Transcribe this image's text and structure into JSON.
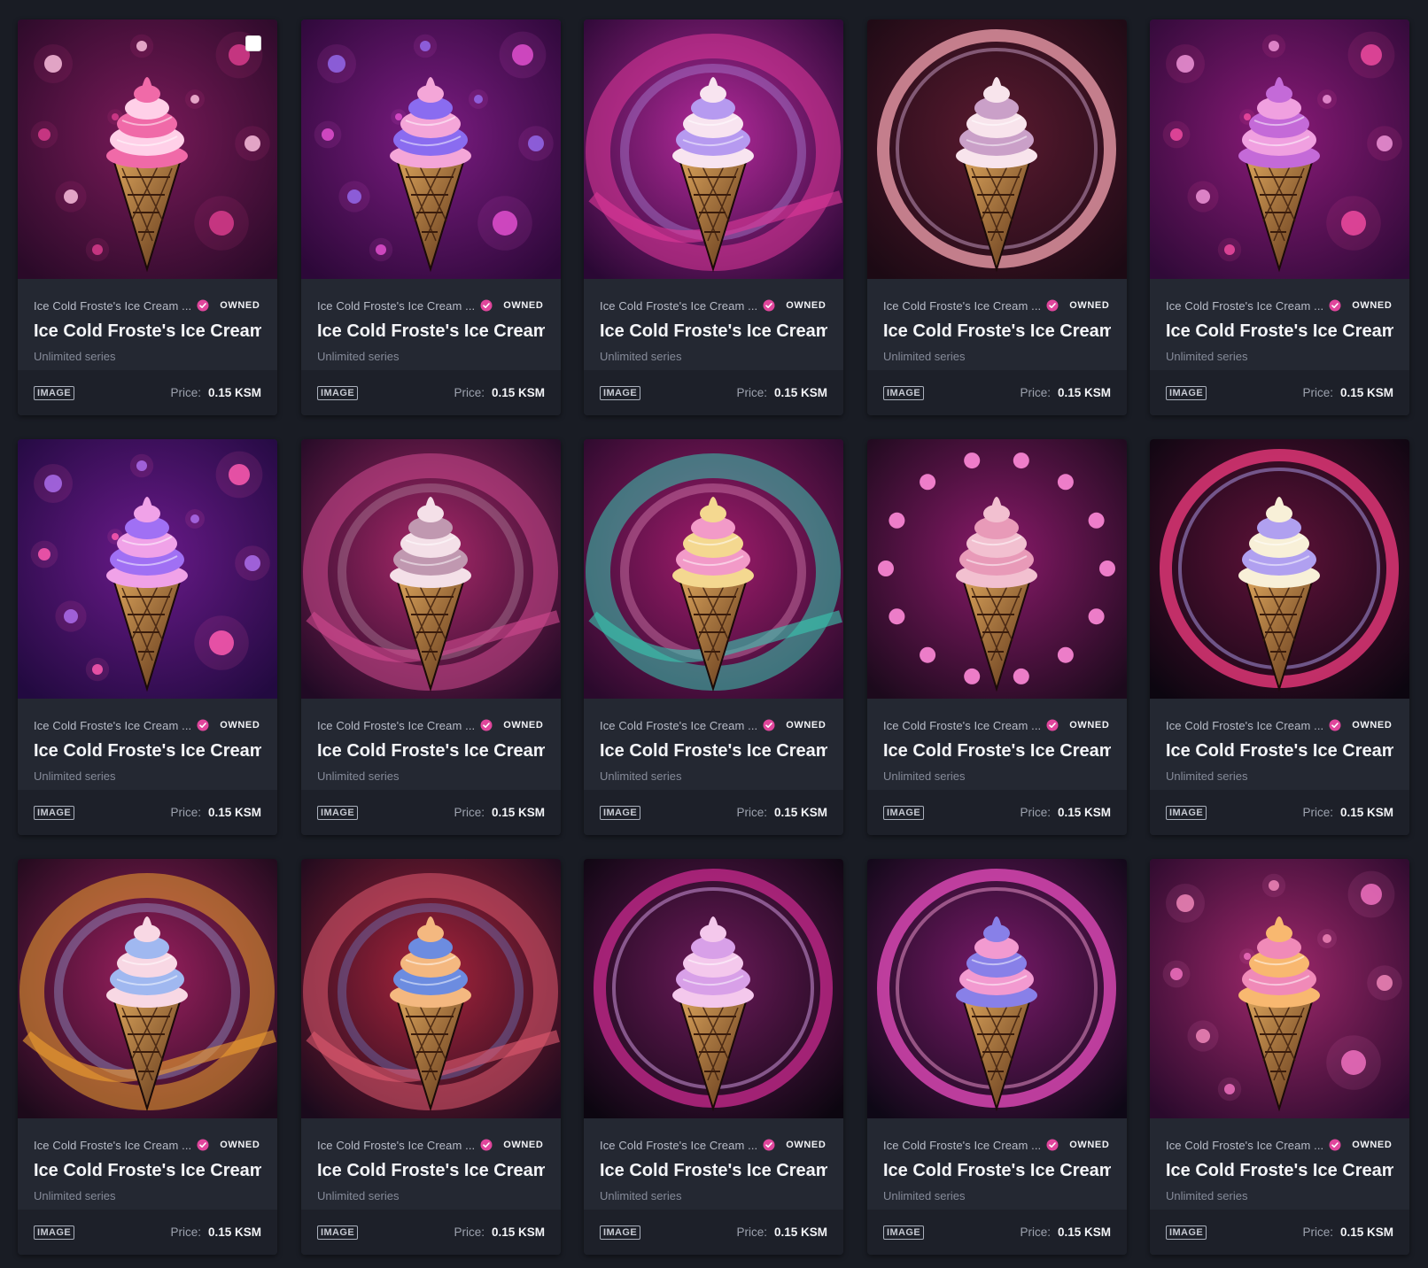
{
  "gallery": {
    "cards": [
      {
        "collection": "Ice Cold Froste's Ice Cream ...",
        "owned": "OWNED",
        "name": "Ice Cold Froste's Ice Cream S",
        "series": "Unlimited series",
        "media": "IMAGE",
        "price_label": "Price:",
        "price": "0.15 KSM",
        "art": {
          "bg1": "#7a1a5a",
          "bg2": "#2a0a28",
          "scoop1": "#f06aa8",
          "scoop2": "#ffd0e8",
          "ring": "#d83c8c",
          "style": "bubbles"
        }
      },
      {
        "collection": "Ice Cold Froste's Ice Cream ...",
        "owned": "OWNED",
        "name": "Ice Cold Froste's Ice Cream S",
        "series": "Unlimited series",
        "media": "IMAGE",
        "price_label": "Price:",
        "price": "0.15 KSM",
        "art": {
          "bg1": "#7c1c82",
          "bg2": "#2c0838",
          "scoop1": "#f4a6d8",
          "scoop2": "#8a6cf0",
          "ring": "#e24fcf",
          "style": "bubbles"
        }
      },
      {
        "collection": "Ice Cold Froste's Ice Cream ...",
        "owned": "OWNED",
        "name": "Ice Cold Froste's Ice Cream S",
        "series": "Unlimited series",
        "media": "IMAGE",
        "price_label": "Price:",
        "price": "0.15 KSM",
        "art": {
          "bg1": "#b42a9c",
          "bg2": "#2a0834",
          "scoop1": "#f8e4f0",
          "scoop2": "#b69af0",
          "ring": "#e0389a",
          "style": "swirl"
        }
      },
      {
        "collection": "Ice Cold Froste's Ice Cream ...",
        "owned": "OWNED",
        "name": "Ice Cold Froste's Ice Cream S",
        "series": "Unlimited series",
        "media": "IMAGE",
        "price_label": "Price:",
        "price": "0.15 KSM",
        "art": {
          "bg1": "#5a1a30",
          "bg2": "#1c0a14",
          "scoop1": "#f8e4ec",
          "scoop2": "#caa0c8",
          "ring": "#e89aa8",
          "style": "halo"
        }
      },
      {
        "collection": "Ice Cold Froste's Ice Cream ...",
        "owned": "OWNED",
        "name": "Ice Cold Froste's Ice Cream S",
        "series": "Unlimited series",
        "media": "IMAGE",
        "price_label": "Price:",
        "price": "0.15 KSM",
        "art": {
          "bg1": "#8a1a78",
          "bg2": "#300a38",
          "scoop1": "#c46ad8",
          "scoop2": "#f0a0e0",
          "ring": "#f04aa0",
          "style": "bubbles"
        }
      },
      {
        "collection": "Ice Cold Froste's Ice Cream ...",
        "owned": "OWNED",
        "name": "Ice Cold Froste's Ice Cream S",
        "series": "Unlimited series",
        "media": "IMAGE",
        "price_label": "Price:",
        "price": "0.15 KSM",
        "art": {
          "bg1": "#6a1a8a",
          "bg2": "#220a40",
          "scoop1": "#f0a2e8",
          "scoop2": "#a070f4",
          "ring": "#ff5ab0",
          "style": "bubbles"
        }
      },
      {
        "collection": "Ice Cold Froste's Ice Cream ...",
        "owned": "OWNED",
        "name": "Ice Cold Froste's Ice Cream S",
        "series": "Unlimited series",
        "media": "IMAGE",
        "price_label": "Price:",
        "price": "0.15 KSM",
        "art": {
          "bg1": "#a8286a",
          "bg2": "#200a24",
          "scoop1": "#f4e0e8",
          "scoop2": "#c098b0",
          "ring": "#d04a90",
          "style": "swirl"
        }
      },
      {
        "collection": "Ice Cold Froste's Ice Cream ...",
        "owned": "OWNED",
        "name": "Ice Cold Froste's Ice Cream S",
        "series": "Unlimited series",
        "media": "IMAGE",
        "price_label": "Price:",
        "price": "0.15 KSM",
        "art": {
          "bg1": "#a01c6c",
          "bg2": "#2a0a2c",
          "scoop1": "#f4d890",
          "scoop2": "#f29ac8",
          "ring": "#38c8b0",
          "style": "swirl"
        }
      },
      {
        "collection": "Ice Cold Froste's Ice Cream ...",
        "owned": "OWNED",
        "name": "Ice Cold Froste's Ice Cream S",
        "series": "Unlimited series",
        "media": "IMAGE",
        "price_label": "Price:",
        "price": "0.15 KSM",
        "art": {
          "bg1": "#8a1a6a",
          "bg2": "#1c0a1c",
          "scoop1": "#f2c0d0",
          "scoop2": "#e89ab8",
          "ring": "#ff8ad8",
          "style": "dots"
        }
      },
      {
        "collection": "Ice Cold Froste's Ice Cream ...",
        "owned": "OWNED",
        "name": "Ice Cold Froste's Ice Cream S",
        "series": "Unlimited series",
        "media": "IMAGE",
        "price_label": "Price:",
        "price": "0.15 KSM",
        "art": {
          "bg1": "#60123a",
          "bg2": "#0c0610",
          "scoop1": "#f8f0d8",
          "scoop2": "#b0a0f0",
          "ring": "#e8387a",
          "style": "halo"
        }
      },
      {
        "collection": "Ice Cold Froste's Ice Cream ...",
        "owned": "OWNED",
        "name": "Ice Cold Froste's Ice Cream S",
        "series": "Unlimited series",
        "media": "IMAGE",
        "price_label": "Price:",
        "price": "0.15 KSM",
        "art": {
          "bg1": "#9c2060",
          "bg2": "#1c0a1a",
          "scoop1": "#f8d8e4",
          "scoop2": "#a0b8f0",
          "ring": "#f0a030",
          "style": "swirl"
        }
      },
      {
        "collection": "Ice Cold Froste's Ice Cream ...",
        "owned": "OWNED",
        "name": "Ice Cold Froste's Ice Cream S",
        "series": "Unlimited series",
        "media": "IMAGE",
        "price_label": "Price:",
        "price": "0.15 KSM",
        "art": {
          "bg1": "#a8243c",
          "bg2": "#1a0a1c",
          "scoop1": "#f4b880",
          "scoop2": "#6c8ce0",
          "ring": "#e05a70",
          "style": "swirl"
        }
      },
      {
        "collection": "Ice Cold Froste's Ice Cream ...",
        "owned": "OWNED",
        "name": "Ice Cold Froste's Ice Cream S",
        "series": "Unlimited series",
        "media": "IMAGE",
        "price_label": "Price:",
        "price": "0.15 KSM",
        "art": {
          "bg1": "#6c1a5a",
          "bg2": "#0c0610",
          "scoop1": "#f4c8ec",
          "scoop2": "#d8a0e8",
          "ring": "#c02888",
          "style": "halo"
        }
      },
      {
        "collection": "Ice Cold Froste's Ice Cream ...",
        "owned": "OWNED",
        "name": "Ice Cold Froste's Ice Cream S",
        "series": "Unlimited series",
        "media": "IMAGE",
        "price_label": "Price:",
        "price": "0.15 KSM",
        "art": {
          "bg1": "#7a1a6a",
          "bg2": "#0e0816",
          "scoop1": "#8880e8",
          "scoop2": "#f29ad0",
          "ring": "#e04ab8",
          "style": "halo"
        }
      },
      {
        "collection": "Ice Cold Froste's Ice Cream ...",
        "owned": "OWNED",
        "name": "Ice Cold Froste's Ice Cream S",
        "series": "Unlimited series",
        "media": "IMAGE",
        "price_label": "Price:",
        "price": "0.15 KSM",
        "art": {
          "bg1": "#a0286c",
          "bg2": "#2a0a2c",
          "scoop1": "#f8b870",
          "scoop2": "#f08ab8",
          "ring": "#f070c0",
          "style": "bubbles"
        }
      }
    ]
  }
}
